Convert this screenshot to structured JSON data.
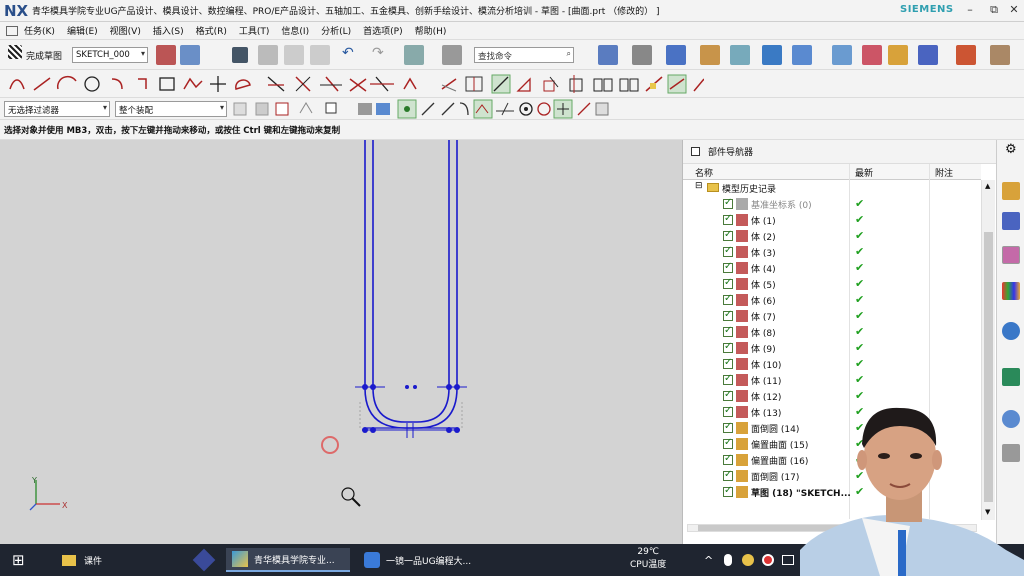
{
  "window": {
    "logo": "NX",
    "title": "青华模具学院专业UG产品设计、模具设计、数控编程、PRO/E产品设计、五轴加工、五金模具、创新手绘设计、模流分析培训 - 草图 - [曲面.prt （修改的） ]",
    "brand": "SIEMENS",
    "minimize": "–",
    "restore": "⧉",
    "close": "✕"
  },
  "menu": [
    "任务(K)",
    "编辑(E)",
    "视图(V)",
    "插入(S)",
    "格式(R)",
    "工具(T)",
    "信息(I)",
    "分析(L)",
    "首选项(P)",
    "帮助(H)"
  ],
  "toolbar": {
    "finish_sketch": "完成草图",
    "sketch_name": "SKETCH_000",
    "search_placeholder": "查找命令",
    "filter": "无选择过滤器",
    "assembly_scope": "整个装配"
  },
  "status_line": "选择对象并使用 MB3，双击，按下左键并拖动来移动，或按住 Ctrl 键和左键拖动来复制",
  "navigator": {
    "title": "部件导航器",
    "columns": {
      "name": "名称",
      "latest": "最新",
      "note": "附注"
    },
    "root": "模型历史记录",
    "items": [
      {
        "label": "基准坐标系 (0)",
        "dim": true
      },
      {
        "label": "体 (1)"
      },
      {
        "label": "体 (2)"
      },
      {
        "label": "体 (3)"
      },
      {
        "label": "体 (4)"
      },
      {
        "label": "体 (5)"
      },
      {
        "label": "体 (6)"
      },
      {
        "label": "体 (7)"
      },
      {
        "label": "体 (8)"
      },
      {
        "label": "体 (9)"
      },
      {
        "label": "体 (10)"
      },
      {
        "label": "体 (11)"
      },
      {
        "label": "体 (12)"
      },
      {
        "label": "体 (13)"
      },
      {
        "label": "面倒圆 (14)"
      },
      {
        "label": "偏置曲面 (15)"
      },
      {
        "label": "偏置曲面 (16)"
      },
      {
        "label": "面倒圆 (17)"
      },
      {
        "label": "草图 (18) \"SKETCH...",
        "bold": true
      }
    ],
    "tick": "✔"
  },
  "axes": {
    "x": "X",
    "y": "Y"
  },
  "taskbar": {
    "start": "⊞",
    "items": [
      "课件",
      "青华模具学院专业...",
      "一镜一品UG编程大..."
    ],
    "weather_temp": "29℃",
    "weather_label": "CPU温度"
  },
  "colors": {
    "sketch": "#1a1acc",
    "accent": "#2a4f8a"
  }
}
